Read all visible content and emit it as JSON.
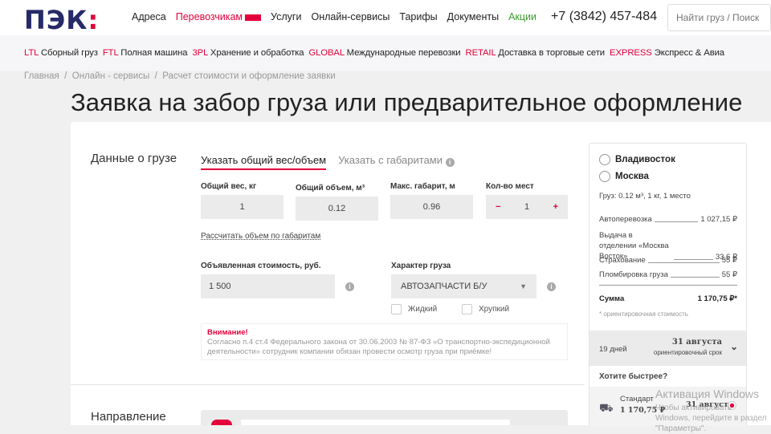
{
  "header": {
    "logo": "ПЭК",
    "nav": [
      "Адреса",
      "Перевозчикам",
      "Услуги",
      "Онлайн-сервисы",
      "Тарифы",
      "Документы",
      "Акции"
    ],
    "phone": "+7 (3842) 457-484",
    "search_placeholder": "Найти груз / Поиск"
  },
  "subnav": [
    {
      "tag": "LTL",
      "label": "Сборный груз"
    },
    {
      "tag": "FTL",
      "label": "Полная машина"
    },
    {
      "tag": "3PL",
      "label": "Хранение и обработка"
    },
    {
      "tag": "GLOBAL",
      "label": "Международные перевозки"
    },
    {
      "tag": "RETAIL",
      "label": "Доставка в торговые сети"
    },
    {
      "tag": "EXPRESS",
      "label": "Экспресс & Авиа"
    }
  ],
  "breadcrumb": "Главная  /  Онлайн - сервисы  /  Расчет стоимости и оформление заявки",
  "title": "Заявка на забор груза или предварительное оформление",
  "cargo": {
    "section": "Данные о грузе",
    "tab_active": "Указать общий вес/объем",
    "tab_inactive": "Указать с габаритами",
    "weight_label": "Общий вес, кг",
    "weight": "1",
    "volume_label": "Общий объем, м³",
    "volume": "0.12",
    "max_label": "Макс. габарит, м",
    "max": "0.96",
    "places_label": "Кол-во мест",
    "places": "1",
    "minus": "−",
    "plus": "+",
    "calc_link": "Рассчитать объем по габаритам",
    "value_label": "Объявленная стоимость, руб.",
    "value": "1 500",
    "type_label": "Характер груза",
    "type": "АВТОЗАПЧАСТИ Б/У",
    "liquid": "Жидкий",
    "fragile": "Хрупкий",
    "warn_title": "Внимание!",
    "warn_text": "Согласно п.4 ст.4 Федерального закона от 30.06.2003 № 87-ФЗ «О транспортно-экспедиционной деятельности» сотрудник компании обязан провести осмотр груза при приёмке!"
  },
  "direction": {
    "section": "Направление"
  },
  "summary": {
    "from": "Владивосток",
    "to": "Москва",
    "cargo": "Груз: 0.12 м³, 1 кг, 1 место",
    "rows": [
      {
        "label": "Автоперевозка",
        "value": "1 027,15 ₽"
      },
      {
        "label": "Выдача в отделении «Москва Восток»",
        "value": "33,6 ₽"
      },
      {
        "label": "Страхование",
        "value": "55 ₽"
      },
      {
        "label": "Пломбировка груза",
        "value": "55 ₽"
      }
    ],
    "total_label": "Сумма",
    "total": "1 170,75 ₽*",
    "note": "* ориентировочная стоимость",
    "days": "19 дней",
    "date": "31 августа",
    "date_note": "ориентировочный срок",
    "faster": "Хотите быстрее?",
    "std_label": "Стандарт",
    "std_price": "1 170,75 ₽",
    "std_date": "31 августа"
  },
  "watermark": {
    "title": "Активация Windows",
    "text": "Чтобы активировать Windows, перейдите в раздел \"Параметры\"."
  }
}
